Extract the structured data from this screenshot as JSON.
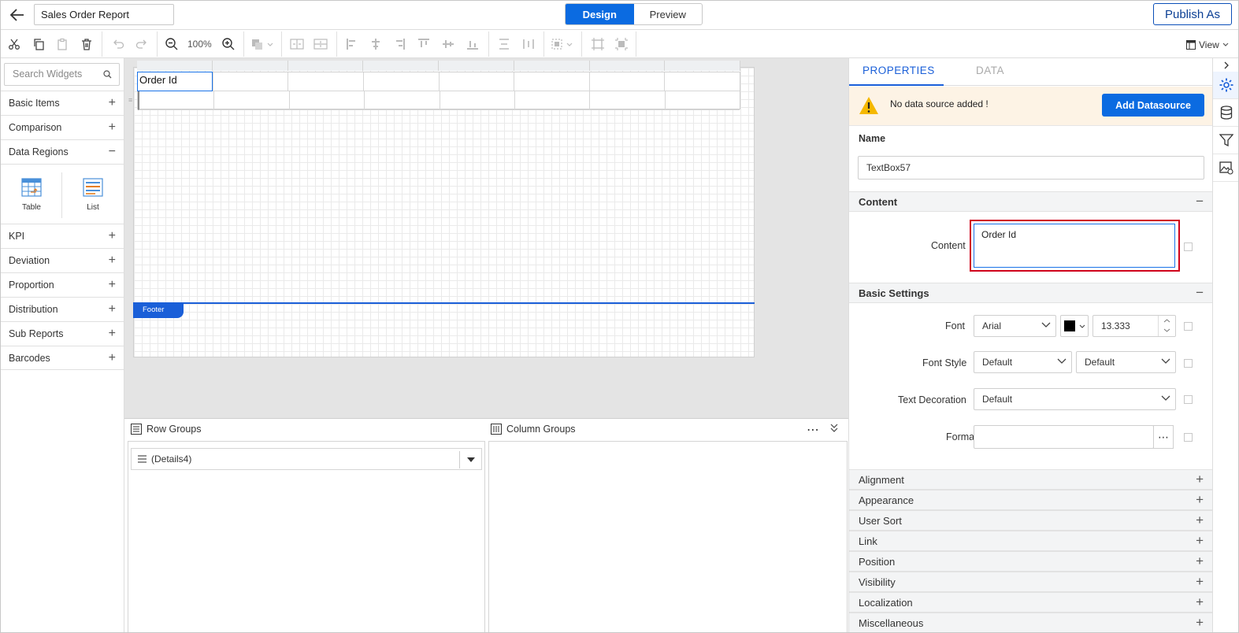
{
  "header": {
    "report_title": "Sales Order Report",
    "mode_design": "Design",
    "mode_preview": "Preview",
    "publish_label": "Publish As"
  },
  "toolbar": {
    "zoom": "100%",
    "view_label": "View"
  },
  "left_panel": {
    "search_placeholder": "Search Widgets",
    "categories": [
      {
        "label": "Basic Items",
        "state": "+"
      },
      {
        "label": "Comparison",
        "state": "+"
      },
      {
        "label": "Data Regions",
        "state": "−"
      },
      {
        "label": "KPI",
        "state": "+"
      },
      {
        "label": "Deviation",
        "state": "+"
      },
      {
        "label": "Proportion",
        "state": "+"
      },
      {
        "label": "Distribution",
        "state": "+"
      },
      {
        "label": "Sub Reports",
        "state": "+"
      },
      {
        "label": "Barcodes",
        "state": "+"
      }
    ],
    "widgets": [
      {
        "label": "Table",
        "icon": "table-icon"
      },
      {
        "label": "List",
        "icon": "list-icon"
      }
    ]
  },
  "canvas": {
    "selected_cell_text": "Order Id",
    "footer_label": "Footer"
  },
  "groups": {
    "row_groups_label": "Row Groups",
    "column_groups_label": "Column Groups",
    "row_group_item": "(Details4)"
  },
  "properties": {
    "tab_properties": "PROPERTIES",
    "tab_data": "DATA",
    "warning_text": "No data source added !",
    "add_datasource": "Add Datasource",
    "name_label": "Name",
    "name_value": "TextBox57",
    "content_section": "Content",
    "content_label": "Content",
    "content_value": "Order Id",
    "basic_settings": "Basic Settings",
    "font_label": "Font",
    "font_family": "Arial",
    "font_size": "13.333",
    "font_color": "#000000",
    "font_style_label": "Font Style",
    "font_style_value": "Default",
    "font_weight_value": "Default",
    "text_decoration_label": "Text Decoration",
    "text_decoration_value": "Default",
    "format_label": "Format",
    "format_value": "",
    "collapsed_sections": [
      "Alignment",
      "Appearance",
      "User Sort",
      "Link",
      "Position",
      "Visibility",
      "Localization",
      "Miscellaneous"
    ]
  },
  "colors": {
    "accent": "#0b6be1",
    "highlight_border": "#d0021b",
    "warning_bg": "#fdf3e5"
  }
}
